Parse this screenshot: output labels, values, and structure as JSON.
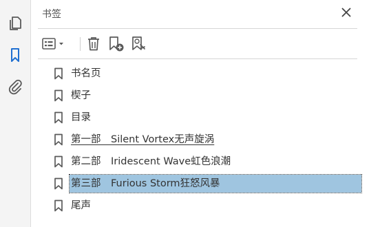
{
  "panel": {
    "title": "书签",
    "close_icon": "close-icon"
  },
  "rail": {
    "items": [
      {
        "name": "pages-icon",
        "active": false
      },
      {
        "name": "bookmark-icon",
        "active": true
      },
      {
        "name": "attachment-icon",
        "active": false
      }
    ]
  },
  "toolbar": {
    "items": [
      {
        "name": "options-menu-button",
        "icon": "list-options-icon"
      },
      {
        "name": "delete-bookmark-button",
        "icon": "trash-icon"
      },
      {
        "name": "new-bookmark-button",
        "icon": "bookmark-add-icon"
      },
      {
        "name": "find-bookmark-button",
        "icon": "bookmark-search-icon"
      }
    ]
  },
  "bookmarks": [
    {
      "label": "书名页",
      "underlined": false,
      "selected": false
    },
    {
      "label": "楔子",
      "underlined": false,
      "selected": false
    },
    {
      "label": "目录",
      "underlined": false,
      "selected": false
    },
    {
      "label": "第一部　Silent Vortex无声旋涡",
      "underlined": true,
      "selected": false
    },
    {
      "label": "第二部　Iridescent Wave虹色浪潮",
      "underlined": false,
      "selected": false
    },
    {
      "label": "第三部　Furious Storm狂怒风暴",
      "underlined": false,
      "selected": true
    },
    {
      "label": "尾声",
      "underlined": false,
      "selected": false
    }
  ],
  "colors": {
    "accent": "#1f6fd1",
    "selection": "#9fc5e0",
    "icon": "#5a5a5a"
  }
}
